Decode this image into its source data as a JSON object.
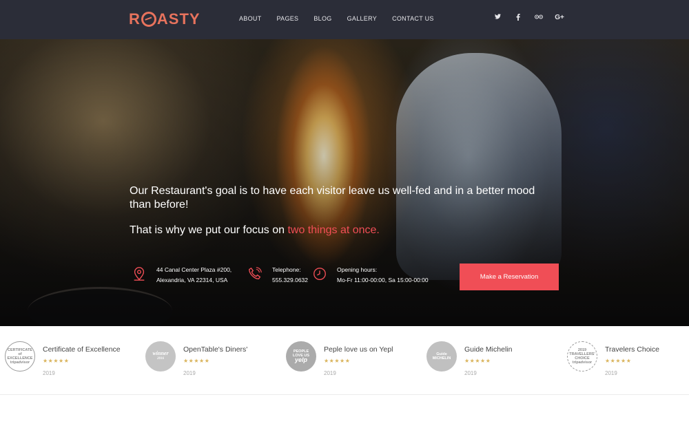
{
  "brand": {
    "logo": "ROASTY",
    "accent": "#e8735d"
  },
  "nav": {
    "items": [
      "ABOUT",
      "PAGES",
      "BLOG",
      "GALLERY",
      "CONTACT US"
    ]
  },
  "social": [
    {
      "icon": "twitter-icon",
      "glyph": "𝕥"
    },
    {
      "icon": "facebook-icon",
      "glyph": "f"
    },
    {
      "icon": "tripadvisor-icon",
      "glyph": "◎◎"
    },
    {
      "icon": "google-plus-icon",
      "glyph": "G+"
    }
  ],
  "hero": {
    "headline": "Our Restaurant's goal is to have each visitor leave us well-fed and in a better mood than before!",
    "focus_prefix": "That is why we put our focus on ",
    "focus_accent": "two things at once.",
    "accent_color": "#f04e56",
    "address": {
      "line1": "44 Canal Center Plaza #200,",
      "line2": "Alexandria, VA 22314, USA"
    },
    "phone": {
      "label": "Telephone:",
      "value": "555.329.0632"
    },
    "hours": {
      "label": "Opening hours:",
      "value": "Mo-Fr 11:00-00:00, Sa 15:00-00:00"
    },
    "cta": "Make a Reservation"
  },
  "awards": [
    {
      "name": "Certificate of Excellence",
      "stars": "★★★★★",
      "year": "2019",
      "badge": "CERTIFICATE of EXCELLENCE tripadvisor",
      "badge_color": "#ffffff"
    },
    {
      "name": "OpenTable's Diners'",
      "stars": "★★★★★",
      "year": "2019",
      "badge": "winner 2016",
      "badge_color": "#bdbdbd"
    },
    {
      "name": "Peple love us on Yepl",
      "stars": "★★★★★",
      "year": "2019",
      "badge": "PEOPLE LOVE US yelp",
      "badge_color": "#a9a9a9"
    },
    {
      "name": "Guide Michelin",
      "stars": "★★★★★",
      "year": "2019",
      "badge": "Guide MICHELIN",
      "badge_color": "#bfbfbf"
    },
    {
      "name": "Travelers Choice",
      "stars": "★★★★★",
      "year": "2019",
      "badge": "2019 TRAVELLERS' CHOICE tripadvisor",
      "badge_color": "#ffffff"
    }
  ]
}
